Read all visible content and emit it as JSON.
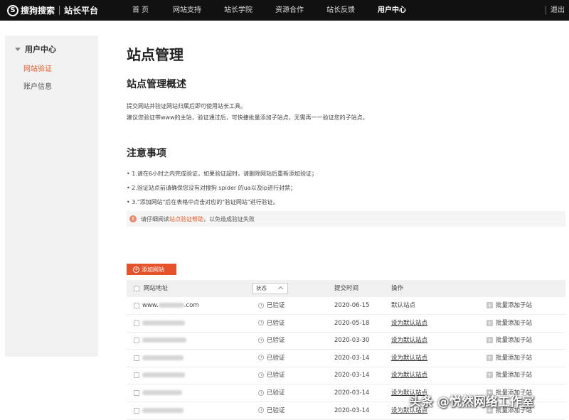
{
  "nav": {
    "logo_mark": "S",
    "brand": "搜狗搜索",
    "platform": "站长平台",
    "items": [
      "首 页",
      "网站支持",
      "站长学院",
      "资源合作",
      "站长反馈",
      "用户中心"
    ],
    "active_index": 5,
    "logout": "退出"
  },
  "sidebar": {
    "heading": "用户中心",
    "items": [
      {
        "label": "网站验证",
        "active": true
      },
      {
        "label": "账户信息",
        "active": false
      }
    ]
  },
  "main": {
    "title": "站点管理",
    "overview_heading": "站点管理概述",
    "overview_lines": [
      "提交网站并验证网站归属后即可使用站长工具。",
      "建议您验证带www的主站，验证通过后，可快捷批量添加子站点，无需再一一验证您的子站点。"
    ],
    "notes_heading": "注意事项",
    "notes": [
      "• 1.请在6小时之内完成验证，如果验证超时，请删除网站后重新添加验证；",
      "• 2.验证站点前请确保您没有对搜狗 spider 的ua以及ip进行封禁；",
      "• 3.\"添加网站\"后在表格中点击对应的\"验证网站\"进行验证。"
    ],
    "warning_before": "请仔细阅读",
    "warning_link": "站点验证帮助",
    "warning_after": "，以免造成验证失败",
    "add_button": "添加网站"
  },
  "table": {
    "headers": {
      "url": "网站地址",
      "status_select": "状态",
      "time": "提交时间",
      "action": "操作"
    },
    "rows": [
      {
        "url_prefix": "www.",
        "url_suffix": ".com",
        "status": "已验证",
        "time": "2020-06-15",
        "action": "默认站点",
        "action_is_link": false,
        "extra": "批量添加子站"
      },
      {
        "url_prefix": "",
        "url_suffix": "",
        "status": "已验证",
        "time": "2020-05-18",
        "action": "设为默认站点",
        "action_is_link": true,
        "extra": "批量添加子站"
      },
      {
        "url_prefix": "",
        "url_suffix": "",
        "status": "已验证",
        "time": "2020-03-30",
        "action": "设为默认站点",
        "action_is_link": true,
        "extra": "批量添加子站"
      },
      {
        "url_prefix": "",
        "url_suffix": "",
        "status": "已验证",
        "time": "2020-03-14",
        "action": "设为默认站点",
        "action_is_link": true,
        "extra": "批量添加子站"
      },
      {
        "url_prefix": "",
        "url_suffix": "",
        "status": "已验证",
        "time": "2020-03-14",
        "action": "设为默认站点",
        "action_is_link": true,
        "extra": "批量添加子站"
      },
      {
        "url_prefix": "",
        "url_suffix": "",
        "status": "已验证",
        "time": "2020-03-14",
        "action": "设为默认站点",
        "action_is_link": true,
        "extra": "批量添加子站"
      },
      {
        "url_prefix": "",
        "url_suffix": "",
        "status": "已验证",
        "time": "2020-03-14",
        "action": "设为默认站点",
        "action_is_link": true,
        "extra": "批量添加子站"
      }
    ]
  },
  "watermark": "头条 @悦然网络工作室",
  "colors": {
    "accent": "#e8522b",
    "topbar": "#111111",
    "sidebar_bg": "#f2f2f2"
  }
}
